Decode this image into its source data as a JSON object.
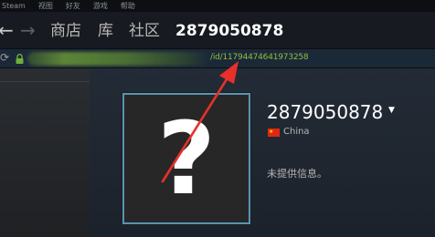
{
  "menu": {
    "items": [
      "Steam",
      "视图",
      "好友",
      "游戏",
      "帮助"
    ]
  },
  "nav": {
    "store": "商店",
    "library": "库",
    "community": "社区",
    "username": "2879050878"
  },
  "address": {
    "url_visible": "/id/11794474641973258"
  },
  "profile": {
    "persona_name": "2879050878",
    "country": "China",
    "no_info": "未提供信息。",
    "avatar_placeholder": "?"
  },
  "colors": {
    "accent_border": "#5a93b2",
    "annotation_arrow": "#e8302a",
    "url_green": "#8fbf3f"
  }
}
